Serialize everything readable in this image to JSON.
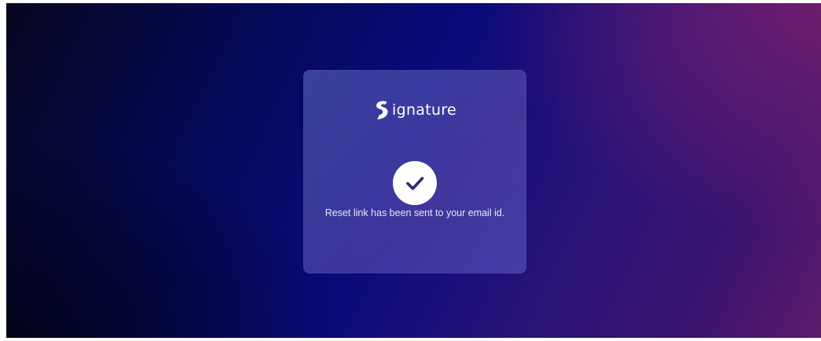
{
  "brand": {
    "name_rest": "ignature"
  },
  "status": {
    "icon": "check-circle-icon",
    "message": "Reset link has been sent to your email id."
  },
  "colors": {
    "check_fill": "#ffffff",
    "check_mark": "#2c2a7a"
  }
}
